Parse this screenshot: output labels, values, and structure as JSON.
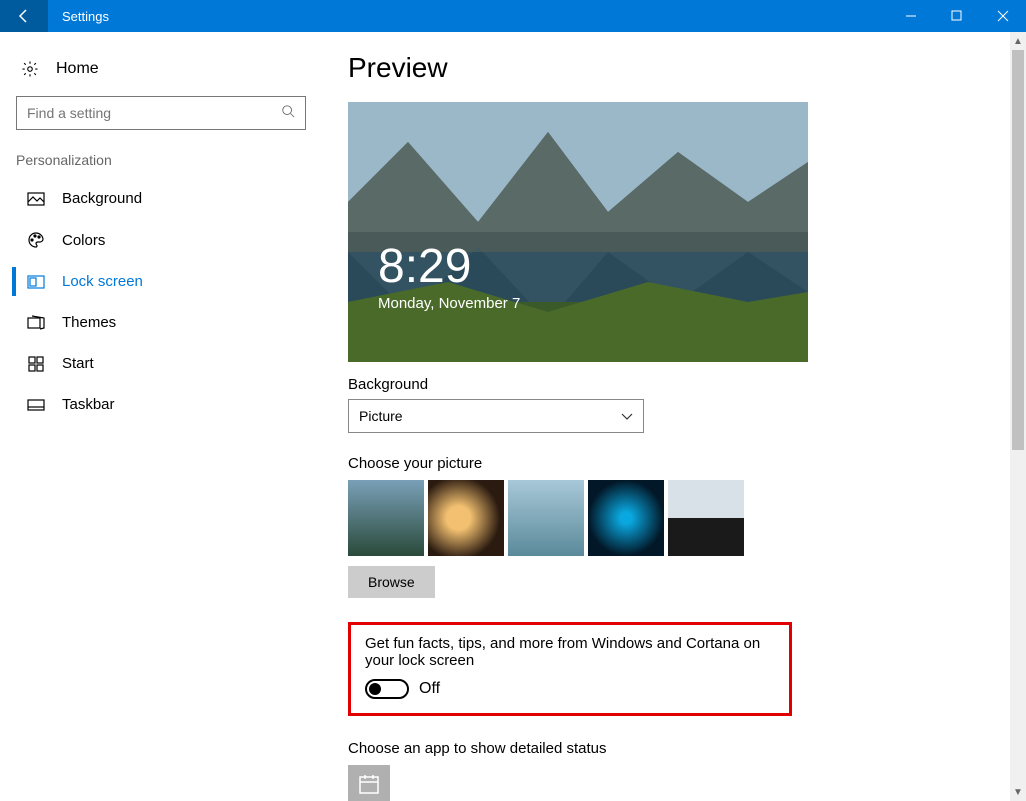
{
  "titlebar": {
    "title": "Settings"
  },
  "sidebar": {
    "home": "Home",
    "search_placeholder": "Find a setting",
    "section": "Personalization",
    "items": [
      {
        "label": "Background"
      },
      {
        "label": "Colors"
      },
      {
        "label": "Lock screen"
      },
      {
        "label": "Themes"
      },
      {
        "label": "Start"
      },
      {
        "label": "Taskbar"
      }
    ]
  },
  "main": {
    "heading": "Preview",
    "preview_time": "8:29",
    "preview_date": "Monday, November 7",
    "background_label": "Background",
    "background_value": "Picture",
    "choose_label": "Choose your picture",
    "browse": "Browse",
    "fun_facts_label": "Get fun facts, tips, and more from Windows and Cortana on your lock screen",
    "toggle_state": "Off",
    "detailed_status_label": "Choose an app to show detailed status"
  }
}
